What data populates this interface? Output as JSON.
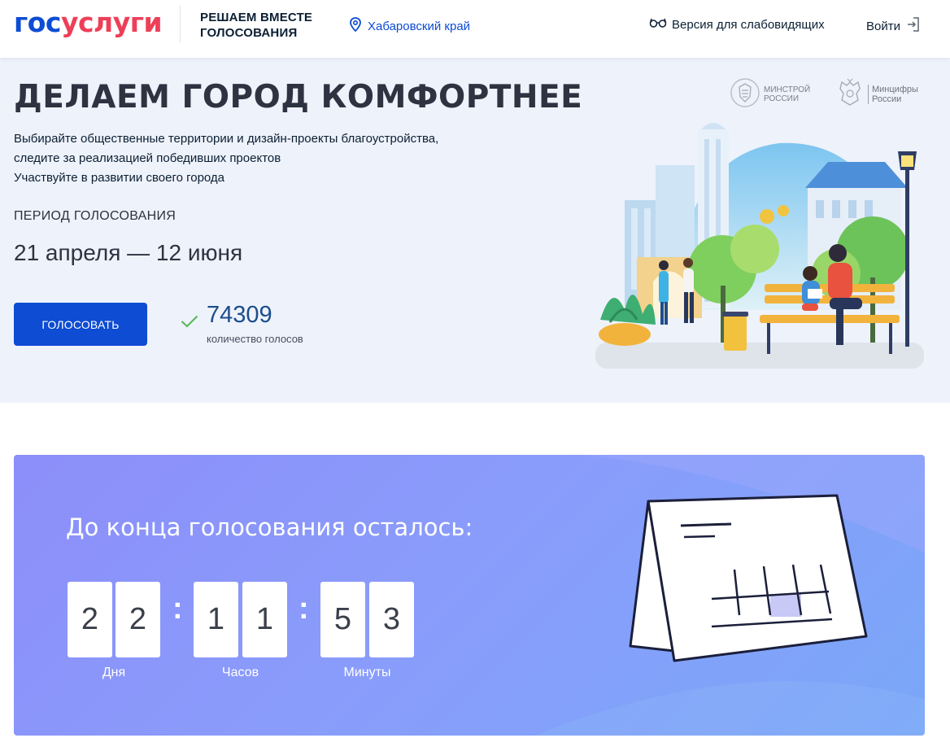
{
  "header": {
    "logo_part1": "гос",
    "logo_part2": "услуги",
    "project_line1": "РЕШАЕМ ВМЕСТЕ",
    "project_line2": "ГОЛОСОВАНИЯ",
    "region": "Хабаровский край",
    "accessibility": "Версия для слабовидящих",
    "login": "Войти"
  },
  "hero": {
    "title": "ДЕЛАЕМ ГОРОД КОМФОРТНЕЕ",
    "text_line1": "Выбирайте общественные территории и дизайн-проекты благоустройства,",
    "text_line2": "следите за реализацией победивших проектов",
    "text_line3": "Участвуйте в развитии своего города",
    "period_label": "ПЕРИОД ГОЛОСОВАНИЯ",
    "period_value": "21 апреля — 12 июня",
    "vote_button": "ГОЛОСОВАТЬ",
    "votes_count": "74309",
    "votes_label": "количество голосов",
    "ministry1_line1": "МИНСТРОЙ",
    "ministry1_line2": "РОССИИ",
    "ministry2_line1": "Минцифры",
    "ministry2_line2": "России"
  },
  "countdown": {
    "title": "До конца голосования осталось:",
    "days": [
      "2",
      "2"
    ],
    "hours": [
      "1",
      "1"
    ],
    "minutes": [
      "5",
      "3"
    ],
    "separator": ":",
    "days_label": "Дня",
    "hours_label": "Часов",
    "minutes_label": "Минуты"
  },
  "colors": {
    "primary": "#0d4cd3",
    "logo_red": "#ee3f58",
    "hero_bg": "#eef2fb",
    "countdown_gradient_start": "#8c8ef9",
    "countdown_gradient_end": "#7aa7f8",
    "check_green": "#5cb85c"
  },
  "icons": {
    "region": "map-pin-icon",
    "accessibility": "glasses-icon",
    "login": "login-arrow-icon",
    "votes": "check-icon"
  }
}
